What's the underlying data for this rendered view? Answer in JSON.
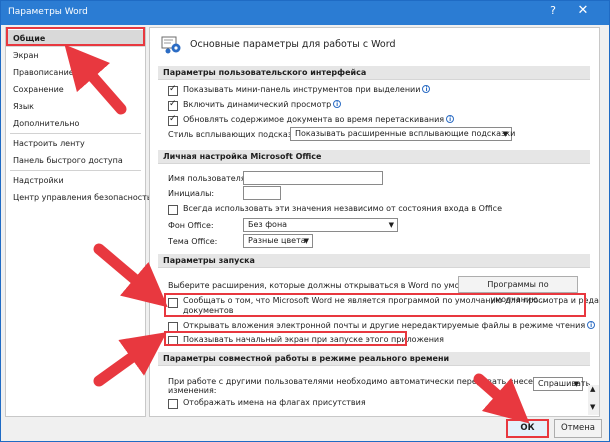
{
  "window": {
    "title": "Параметры Word",
    "help_glyph": "?",
    "close_glyph": "✕"
  },
  "nav": {
    "items": [
      {
        "label": "Общие"
      },
      {
        "label": "Экран"
      },
      {
        "label": "Правописание"
      },
      {
        "label": "Сохранение"
      },
      {
        "label": "Язык"
      },
      {
        "label": "Дополнительно"
      },
      {
        "label": "Настроить ленту"
      },
      {
        "label": "Панель быстрого доступа"
      },
      {
        "label": "Надстройки"
      },
      {
        "label": "Центр управления безопасностью"
      }
    ],
    "selected_index": 0
  },
  "main": {
    "header_title": "Основные параметры для работы с Word",
    "ui_section": {
      "title": "Параметры пользовательского интерфейса",
      "options": [
        {
          "label": "Показывать мини-панель инструментов при выделении",
          "checked": true,
          "info": true
        },
        {
          "label": "Включить динамический просмотр",
          "checked": true,
          "info": true
        },
        {
          "label": "Обновлять содержимое документа во время перетаскивания",
          "checked": true,
          "info": true
        }
      ],
      "tooltip_style_label": "Стиль всплывающих подсказок:",
      "tooltip_style_value": "Показывать расширенные всплывающие подсказки"
    },
    "personal_section": {
      "title": "Личная настройка Microsoft Office",
      "username_label": "Имя пользователя:",
      "username_value": "",
      "initials_label": "Инициалы:",
      "initials_value": "",
      "always_use_label": "Всегда использовать эти значения независимо от состояния входа в Office",
      "always_use_checked": false,
      "background_label": "Фон Office:",
      "background_value": "Без фона",
      "theme_label": "Тема Office:",
      "theme_value": "Разные цвета"
    },
    "startup_section": {
      "title": "Параметры запуска",
      "default_ext_label": "Выберите расширения, которые должны открываться в Word по умолчанию:",
      "default_programs_button": "Программы по умолчанию...",
      "notify_default_label_line1": "Сообщать о том, что Microsoft Word не является программой по умолчанию для просмотра и редактирования",
      "notify_default_label_line2": "документов",
      "notify_default_checked": false,
      "open_attachments_label": "Открывать вложения электронной почты и другие нередактируемые файлы в режиме чтения",
      "open_attachments_checked": false,
      "show_start_label": "Показывать начальный экран при запуске этого приложения",
      "show_start_checked": false
    },
    "coauth_section": {
      "title": "Параметры совместной работы в режиме реального времени",
      "share_label_line1": "При работе с другими пользователями необходимо автоматически передавать внесенные мной",
      "share_label_line2": "изменения:",
      "share_value": "Спрашивать",
      "show_names_label": "Отображать имена на флагах присутствия",
      "show_names_checked": false
    }
  },
  "footer": {
    "ok_label": "ОК",
    "cancel_label": "Отмена"
  },
  "colors": {
    "titlebar": "#2b7cd3",
    "highlight": "#e8383f"
  }
}
